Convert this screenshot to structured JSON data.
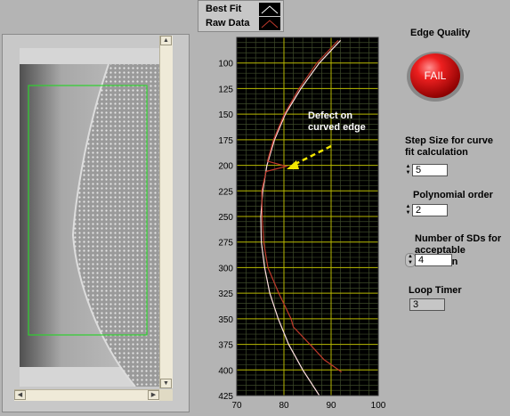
{
  "legend": {
    "items": [
      {
        "label": "Best Fit",
        "color": "#ffffff"
      },
      {
        "label": "Raw Data",
        "color": "#c0392b"
      }
    ]
  },
  "edge_quality": {
    "label": "Edge Quality",
    "status": "FAIL",
    "color": "#e01010"
  },
  "controls": {
    "step_size": {
      "label_line1": "Step Size for curve",
      "label_line2": "fit calculation",
      "value": "5"
    },
    "poly_order": {
      "label": "Polynomial order",
      "value": "2"
    },
    "num_sds": {
      "label_line1": "Number of SDs for",
      "label_line2": "acceptable deviation",
      "value": "4"
    },
    "loop_timer": {
      "label": "Loop Timer",
      "value": "3"
    }
  },
  "annotation": {
    "line1": "Defect on",
    "line2": "curved edge",
    "color": "#f2e600"
  },
  "chart_data": {
    "type": "line",
    "xlim": [
      70,
      100
    ],
    "ylim": [
      75,
      425
    ],
    "y_inverted": true,
    "grid": true,
    "xticks": [
      70,
      80,
      90,
      100
    ],
    "yticks": [
      100,
      125,
      150,
      175,
      200,
      225,
      250,
      275,
      300,
      325,
      350,
      375,
      400,
      425
    ],
    "series": [
      {
        "name": "Best Fit",
        "color": "#ffe0e0",
        "x": [
          92.0,
          87.5,
          83.6,
          80.3,
          78.0,
          76.4,
          75.5,
          75.1,
          75.2,
          75.9,
          77.0,
          78.8,
          81.0,
          84.0,
          87.5,
          92.0
        ],
        "y": [
          78,
          100,
          125,
          150,
          175,
          200,
          225,
          250,
          275,
          300,
          325,
          350,
          375,
          400,
          425,
          450
        ]
      },
      {
        "name": "Raw Data",
        "color": "#c0392b",
        "x": [
          91.5,
          87.0,
          83.2,
          80.1,
          77.8,
          76.5,
          80.5,
          76.2,
          75.3,
          75.4,
          75.7,
          76.6,
          78.9,
          81.5,
          82.0,
          85.5,
          88.5,
          92.2
        ],
        "y": [
          78,
          100,
          125,
          150,
          175,
          196,
          201,
          206,
          225,
          250,
          275,
          300,
          325,
          350,
          358,
          375,
          390,
          402
        ]
      }
    ]
  }
}
